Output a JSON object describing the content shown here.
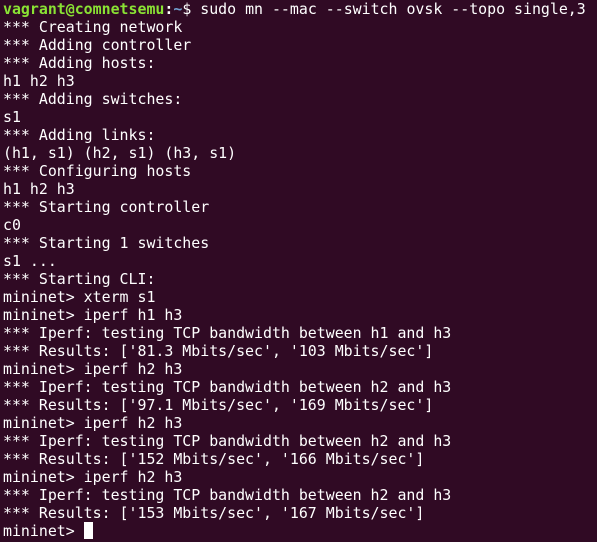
{
  "prompt": {
    "user_host": "vagrant@comnetsemu",
    "separator": ":",
    "path": "~",
    "symbol": "$ ",
    "command": "sudo mn --mac --switch ovsk --topo single,3"
  },
  "output_lines": [
    "*** Creating network",
    "*** Adding controller",
    "*** Adding hosts:",
    "h1 h2 h3",
    "*** Adding switches:",
    "s1",
    "*** Adding links:",
    "(h1, s1) (h2, s1) (h3, s1)",
    "*** Configuring hosts",
    "h1 h2 h3",
    "*** Starting controller",
    "c0",
    "*** Starting 1 switches",
    "s1 ...",
    "*** Starting CLI:",
    "mininet> xterm s1",
    "mininet> iperf h1 h3",
    "*** Iperf: testing TCP bandwidth between h1 and h3",
    "*** Results: ['81.3 Mbits/sec', '103 Mbits/sec']",
    "mininet> iperf h2 h3",
    "*** Iperf: testing TCP bandwidth between h2 and h3",
    "*** Results: ['97.1 Mbits/sec', '169 Mbits/sec']",
    "mininet> iperf h2 h3",
    "*** Iperf: testing TCP bandwidth between h2 and h3",
    "*** Results: ['152 Mbits/sec', '166 Mbits/sec']",
    "mininet> iperf h2 h3",
    "*** Iperf: testing TCP bandwidth between h2 and h3",
    "*** Results: ['153 Mbits/sec', '167 Mbits/sec']"
  ],
  "current_prompt": "mininet> ",
  "colors": {
    "background": "#300a24",
    "foreground": "#ffffff",
    "user_host": "#8ae234",
    "path": "#729fcf"
  }
}
